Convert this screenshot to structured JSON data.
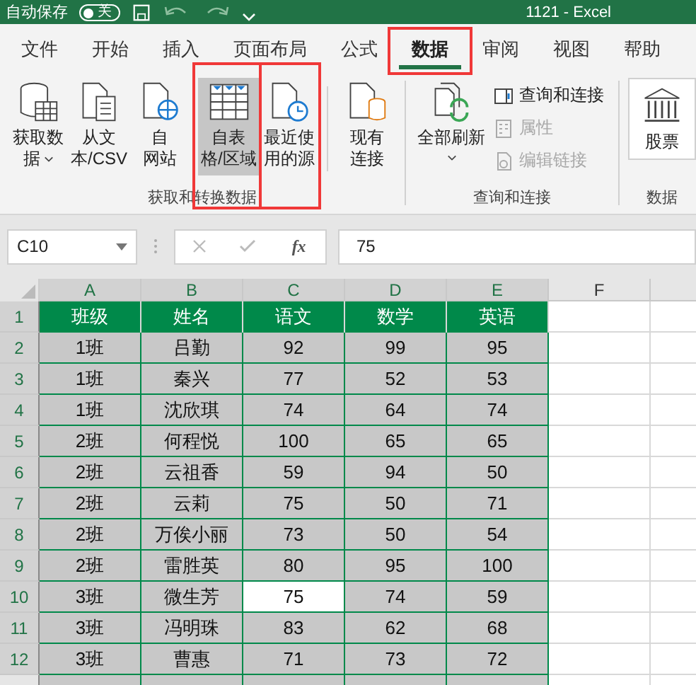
{
  "title_bar": {
    "autosave_label": "自动保存",
    "autosave_toggle": "关",
    "title": "1121  -  Excel"
  },
  "tabs": [
    {
      "label": "文件",
      "selected": false,
      "highlighted": false
    },
    {
      "label": "开始",
      "selected": false,
      "highlighted": false
    },
    {
      "label": "插入",
      "selected": false,
      "highlighted": false
    },
    {
      "label": "页面布局",
      "selected": false,
      "highlighted": false
    },
    {
      "label": "公式",
      "selected": false,
      "highlighted": false
    },
    {
      "label": "数据",
      "selected": true,
      "highlighted": true
    },
    {
      "label": "审阅",
      "selected": false,
      "highlighted": false
    },
    {
      "label": "视图",
      "selected": false,
      "highlighted": false
    },
    {
      "label": "帮助",
      "selected": false,
      "highlighted": false
    }
  ],
  "ribbon": {
    "groups": [
      {
        "label": "获取和转换数据",
        "buttons": [
          {
            "kind": "database",
            "lines": [
              "获取数",
              "据"
            ],
            "dropdown": true,
            "selected": false,
            "highlighted": false
          },
          {
            "kind": "text-file",
            "lines": [
              "从文",
              "本/CSV"
            ],
            "dropdown": false,
            "selected": false,
            "highlighted": false
          },
          {
            "kind": "web",
            "lines": [
              "自",
              "网站"
            ],
            "dropdown": false,
            "selected": false,
            "highlighted": false
          },
          {
            "kind": "table",
            "lines": [
              "自表",
              "格/区域"
            ],
            "dropdown": false,
            "selected": true,
            "highlighted": true
          },
          {
            "kind": "recent",
            "lines": [
              "最近使",
              "用的源"
            ],
            "dropdown": false,
            "selected": false,
            "highlighted": true
          },
          {
            "kind": "connection",
            "lines": [
              "现有",
              "连接"
            ],
            "dropdown": false,
            "selected": false,
            "highlighted": false
          }
        ]
      },
      {
        "label": "查询和连接",
        "buttons": [
          {
            "kind": "refresh",
            "lines": [
              "全部刷新"
            ],
            "dropdown": true,
            "selected": false,
            "highlighted": false
          }
        ],
        "small_items": [
          {
            "kind": "panel",
            "label": "查询和连接",
            "disabled": false
          },
          {
            "kind": "properties",
            "label": "属性",
            "disabled": true
          },
          {
            "kind": "links",
            "label": "编辑链接",
            "disabled": true
          }
        ]
      },
      {
        "label": "数据",
        "buttons": [
          {
            "kind": "stock",
            "lines": [
              "股票"
            ],
            "dropdown": false,
            "selected": false,
            "highlighted": false
          }
        ]
      }
    ]
  },
  "formula_bar": {
    "name_box": "C10",
    "function_label": "fx",
    "formula": "75"
  },
  "columns": [
    {
      "letter": "A",
      "selected": true
    },
    {
      "letter": "B",
      "selected": true
    },
    {
      "letter": "C",
      "selected": true
    },
    {
      "letter": "D",
      "selected": true
    },
    {
      "letter": "E",
      "selected": true
    },
    {
      "letter": "F",
      "selected": false
    }
  ],
  "rows": [
    {
      "number": "1",
      "kind": "header",
      "selected": true,
      "cells": [
        {
          "v": "班级",
          "active": false
        },
        {
          "v": "姓名",
          "active": false
        },
        {
          "v": "语文",
          "active": false
        },
        {
          "v": "数学",
          "active": false
        },
        {
          "v": "英语",
          "active": false
        }
      ]
    },
    {
      "number": "2",
      "kind": "data",
      "selected": true,
      "cells": [
        {
          "v": "1班",
          "active": false
        },
        {
          "v": "吕勤",
          "active": false
        },
        {
          "v": "92",
          "active": false
        },
        {
          "v": "99",
          "active": false
        },
        {
          "v": "95",
          "active": false
        }
      ]
    },
    {
      "number": "3",
      "kind": "data",
      "selected": true,
      "cells": [
        {
          "v": "1班",
          "active": false
        },
        {
          "v": "秦兴",
          "active": false
        },
        {
          "v": "77",
          "active": false
        },
        {
          "v": "52",
          "active": false
        },
        {
          "v": "53",
          "active": false
        }
      ]
    },
    {
      "number": "4",
      "kind": "data",
      "selected": true,
      "cells": [
        {
          "v": "1班",
          "active": false
        },
        {
          "v": "沈欣琪",
          "active": false
        },
        {
          "v": "74",
          "active": false
        },
        {
          "v": "64",
          "active": false
        },
        {
          "v": "74",
          "active": false
        }
      ]
    },
    {
      "number": "5",
      "kind": "data",
      "selected": true,
      "cells": [
        {
          "v": "2班",
          "active": false
        },
        {
          "v": "何程悦",
          "active": false
        },
        {
          "v": "100",
          "active": false
        },
        {
          "v": "65",
          "active": false
        },
        {
          "v": "65",
          "active": false
        }
      ]
    },
    {
      "number": "6",
      "kind": "data",
      "selected": true,
      "cells": [
        {
          "v": "2班",
          "active": false
        },
        {
          "v": "云祖香",
          "active": false
        },
        {
          "v": "59",
          "active": false
        },
        {
          "v": "94",
          "active": false
        },
        {
          "v": "50",
          "active": false
        }
      ]
    },
    {
      "number": "7",
      "kind": "data",
      "selected": true,
      "cells": [
        {
          "v": "2班",
          "active": false
        },
        {
          "v": "云莉",
          "active": false
        },
        {
          "v": "75",
          "active": false
        },
        {
          "v": "50",
          "active": false
        },
        {
          "v": "71",
          "active": false
        }
      ]
    },
    {
      "number": "8",
      "kind": "data",
      "selected": true,
      "cells": [
        {
          "v": "2班",
          "active": false
        },
        {
          "v": "万俟小丽",
          "active": false
        },
        {
          "v": "73",
          "active": false
        },
        {
          "v": "50",
          "active": false
        },
        {
          "v": "54",
          "active": false
        }
      ]
    },
    {
      "number": "9",
      "kind": "data",
      "selected": true,
      "cells": [
        {
          "v": "2班",
          "active": false
        },
        {
          "v": "雷胜英",
          "active": false
        },
        {
          "v": "80",
          "active": false
        },
        {
          "v": "95",
          "active": false
        },
        {
          "v": "100",
          "active": false
        }
      ]
    },
    {
      "number": "10",
      "kind": "data",
      "selected": true,
      "cells": [
        {
          "v": "3班",
          "active": false
        },
        {
          "v": "微生芳",
          "active": false
        },
        {
          "v": "75",
          "active": true
        },
        {
          "v": "74",
          "active": false
        },
        {
          "v": "59",
          "active": false
        }
      ]
    },
    {
      "number": "11",
      "kind": "data",
      "selected": true,
      "cells": [
        {
          "v": "3班",
          "active": false
        },
        {
          "v": "冯明珠",
          "active": false
        },
        {
          "v": "83",
          "active": false
        },
        {
          "v": "62",
          "active": false
        },
        {
          "v": "68",
          "active": false
        }
      ]
    },
    {
      "number": "12",
      "kind": "data",
      "selected": true,
      "cells": [
        {
          "v": "3班",
          "active": false
        },
        {
          "v": "曹惠",
          "active": false
        },
        {
          "v": "71",
          "active": false
        },
        {
          "v": "73",
          "active": false
        },
        {
          "v": "72",
          "active": false
        }
      ]
    }
  ]
}
